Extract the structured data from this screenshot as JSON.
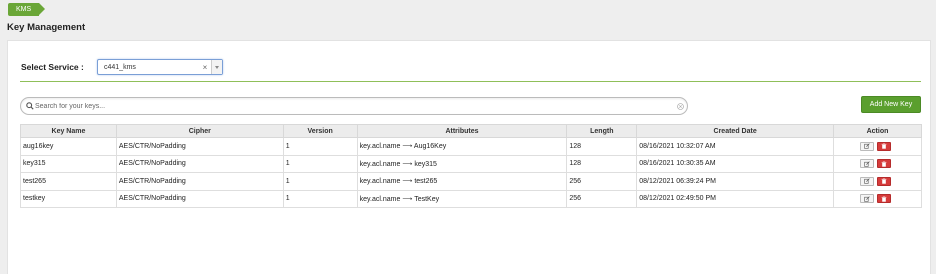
{
  "breadcrumb": {
    "item": "KMS"
  },
  "page_title": "Key Management",
  "service": {
    "label": "Select Service :",
    "selected": "c441_kms",
    "clear_glyph": "×"
  },
  "search": {
    "placeholder": "Search for your keys..."
  },
  "add_key_label": "Add New Key",
  "table": {
    "columns": [
      "Key Name",
      "Cipher",
      "Version",
      "Attributes",
      "Length",
      "Created Date",
      "Action"
    ],
    "rows": [
      {
        "name": "aug16key",
        "cipher": "AES/CTR/NoPadding",
        "version": "1",
        "attr_key": "key.acl.name",
        "attr_value": "Aug16Key",
        "length": "128",
        "created": "08/16/2021 10:32:07 AM"
      },
      {
        "name": "key315",
        "cipher": "AES/CTR/NoPadding",
        "version": "1",
        "attr_key": "key.acl.name",
        "attr_value": "key315",
        "length": "128",
        "created": "08/16/2021 10:30:35 AM"
      },
      {
        "name": "test265",
        "cipher": "AES/CTR/NoPadding",
        "version": "1",
        "attr_key": "key.acl.name",
        "attr_value": "test265",
        "length": "256",
        "created": "08/12/2021 06:39:24 PM"
      },
      {
        "name": "testkey",
        "cipher": "AES/CTR/NoPadding",
        "version": "1",
        "attr_key": "key.acl.name",
        "attr_value": "TestKey",
        "length": "256",
        "created": "08/12/2021 02:49:50 PM"
      }
    ],
    "arrow_glyph": "⟶"
  },
  "colors": {
    "accent_green": "#6aa637",
    "button_green": "#5a9f2e",
    "delete_red": "#d63b3b"
  },
  "icons": [
    "search-icon",
    "clear-icon",
    "chevron-down-icon",
    "edit-icon",
    "trash-icon"
  ]
}
